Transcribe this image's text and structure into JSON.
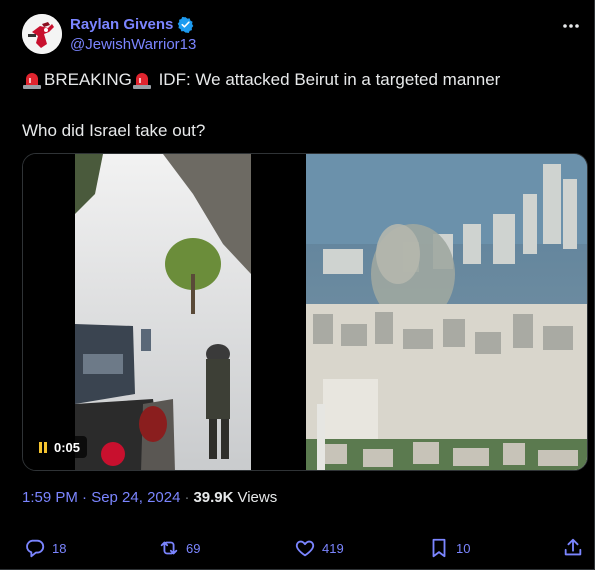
{
  "author": {
    "display_name": "Raylan Givens",
    "handle": "@JewishWarrior13",
    "verified": true,
    "avatar_icon": "gunslinger-avatar-icon"
  },
  "post": {
    "line1_before": "BREAKING",
    "line1_after": " IDF: We attacked Beirut in a targeted manner",
    "line2": "Who did Israel take out?",
    "emoji_icon": "police-siren-icon"
  },
  "media": {
    "video_time": "0:05",
    "pause_icon": "pause-icon"
  },
  "meta": {
    "time": "1:59 PM · Sep 24, 2024",
    "separator": "·",
    "views_count": "39.9K",
    "views_label": "Views"
  },
  "actions": {
    "replies": "18",
    "reposts": "69",
    "likes": "419",
    "bookmarks": "10"
  },
  "colors": {
    "accent": "#7b85ff",
    "verified": "#1d9bf0",
    "muted": "#71767b",
    "text": "#e7e9ea"
  }
}
